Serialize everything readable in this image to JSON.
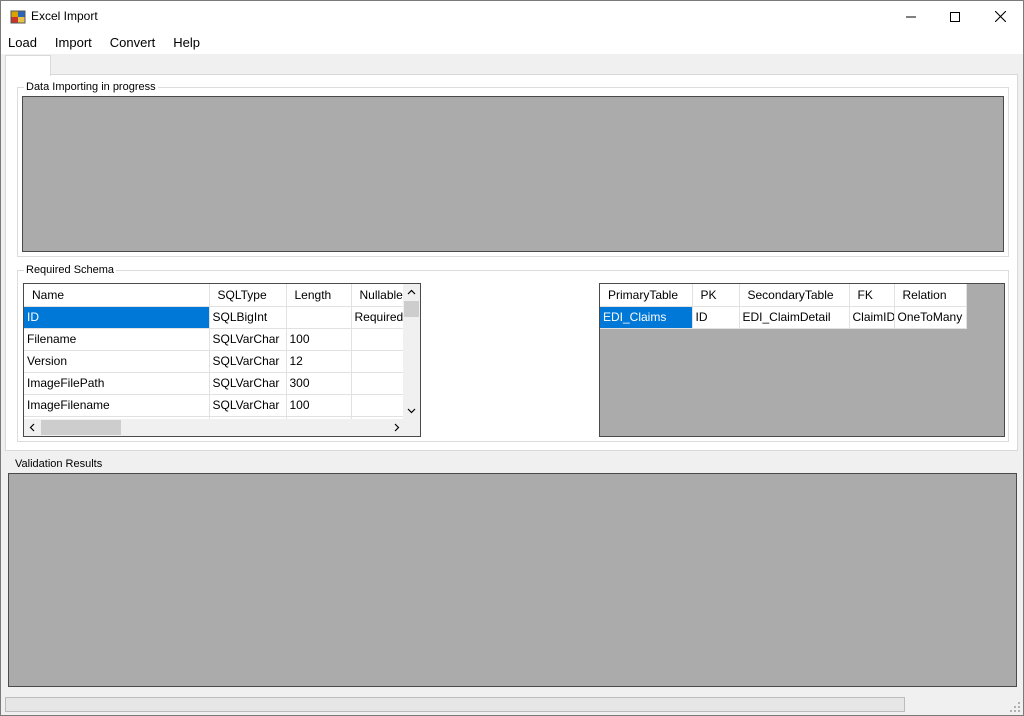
{
  "window": {
    "title": "Excel Import"
  },
  "menu": [
    {
      "label": "Load"
    },
    {
      "label": "Import"
    },
    {
      "label": "Convert"
    },
    {
      "label": "Help"
    }
  ],
  "tab": {
    "label": ""
  },
  "import_group": {
    "label": "Data Importing in progress"
  },
  "schema_group": {
    "label": "Required Schema"
  },
  "validation_group": {
    "label": "Validation Results"
  },
  "schema_grid": {
    "columns": [
      "Name",
      "SQLType",
      "Length",
      "Nullable"
    ],
    "rows": [
      [
        "ID",
        "SQLBigInt",
        "",
        "Required!"
      ],
      [
        "Filename",
        "SQLVarChar",
        "100",
        ""
      ],
      [
        "Version",
        "SQLVarChar",
        "12",
        ""
      ],
      [
        "ImageFilePath",
        "SQLVarChar",
        "300",
        ""
      ],
      [
        "ImageFilename",
        "SQLVarChar",
        "100",
        ""
      ]
    ]
  },
  "relations_grid": {
    "columns": [
      "PrimaryTable",
      "PK",
      "SecondaryTable",
      "FK",
      "Relation"
    ],
    "rows": [
      [
        "EDI_Claims",
        "ID",
        "EDI_ClaimDetail",
        "ClaimID",
        "OneToMany"
      ]
    ]
  },
  "colors": {
    "selection": "#0078d7",
    "panel": "#ababab"
  }
}
